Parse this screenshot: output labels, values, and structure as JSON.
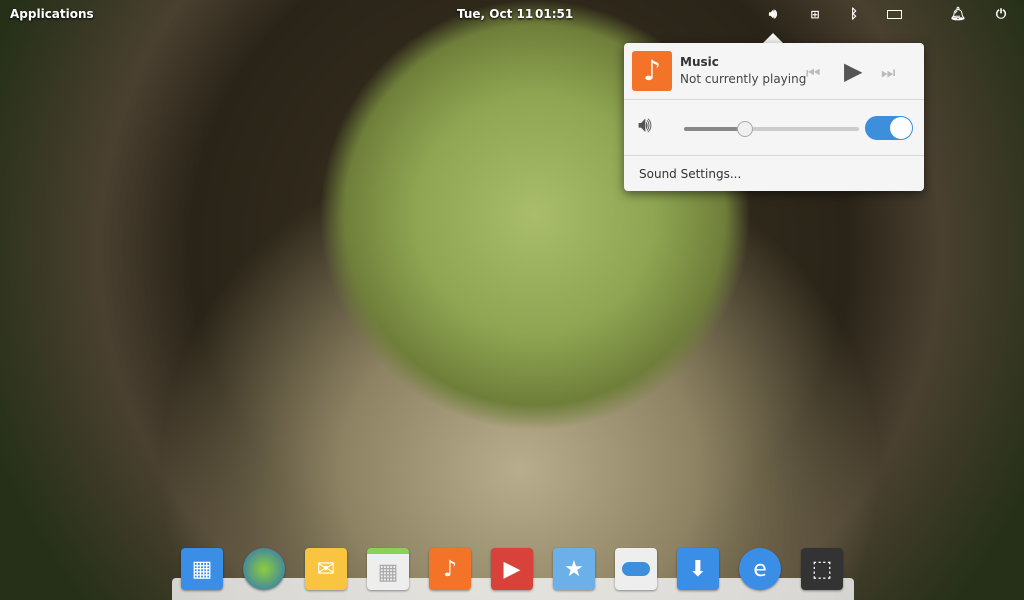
{
  "panel": {
    "applications": "Applications",
    "date": "Tue, Oct 11",
    "time": "01:51"
  },
  "indicators": [
    "volume-icon",
    "network-disconnected-icon",
    "bluetooth-icon",
    "battery-icon",
    "notifications-icon",
    "power-icon"
  ],
  "sound_popover": {
    "player_name": "Music",
    "player_status": "Not currently playing",
    "volume_percent": 35,
    "sound_enabled": true,
    "settings_label": "Sound Settings..."
  },
  "dock": {
    "apps": [
      "Multitasking View",
      "Web Browser",
      "Mail",
      "Calendar",
      "Music",
      "Videos",
      "Photos",
      "System Settings",
      "AppCenter",
      "Installer",
      "Screenshot"
    ]
  },
  "colors": {
    "accent": "#3d8fdc",
    "music": "#f37329"
  }
}
